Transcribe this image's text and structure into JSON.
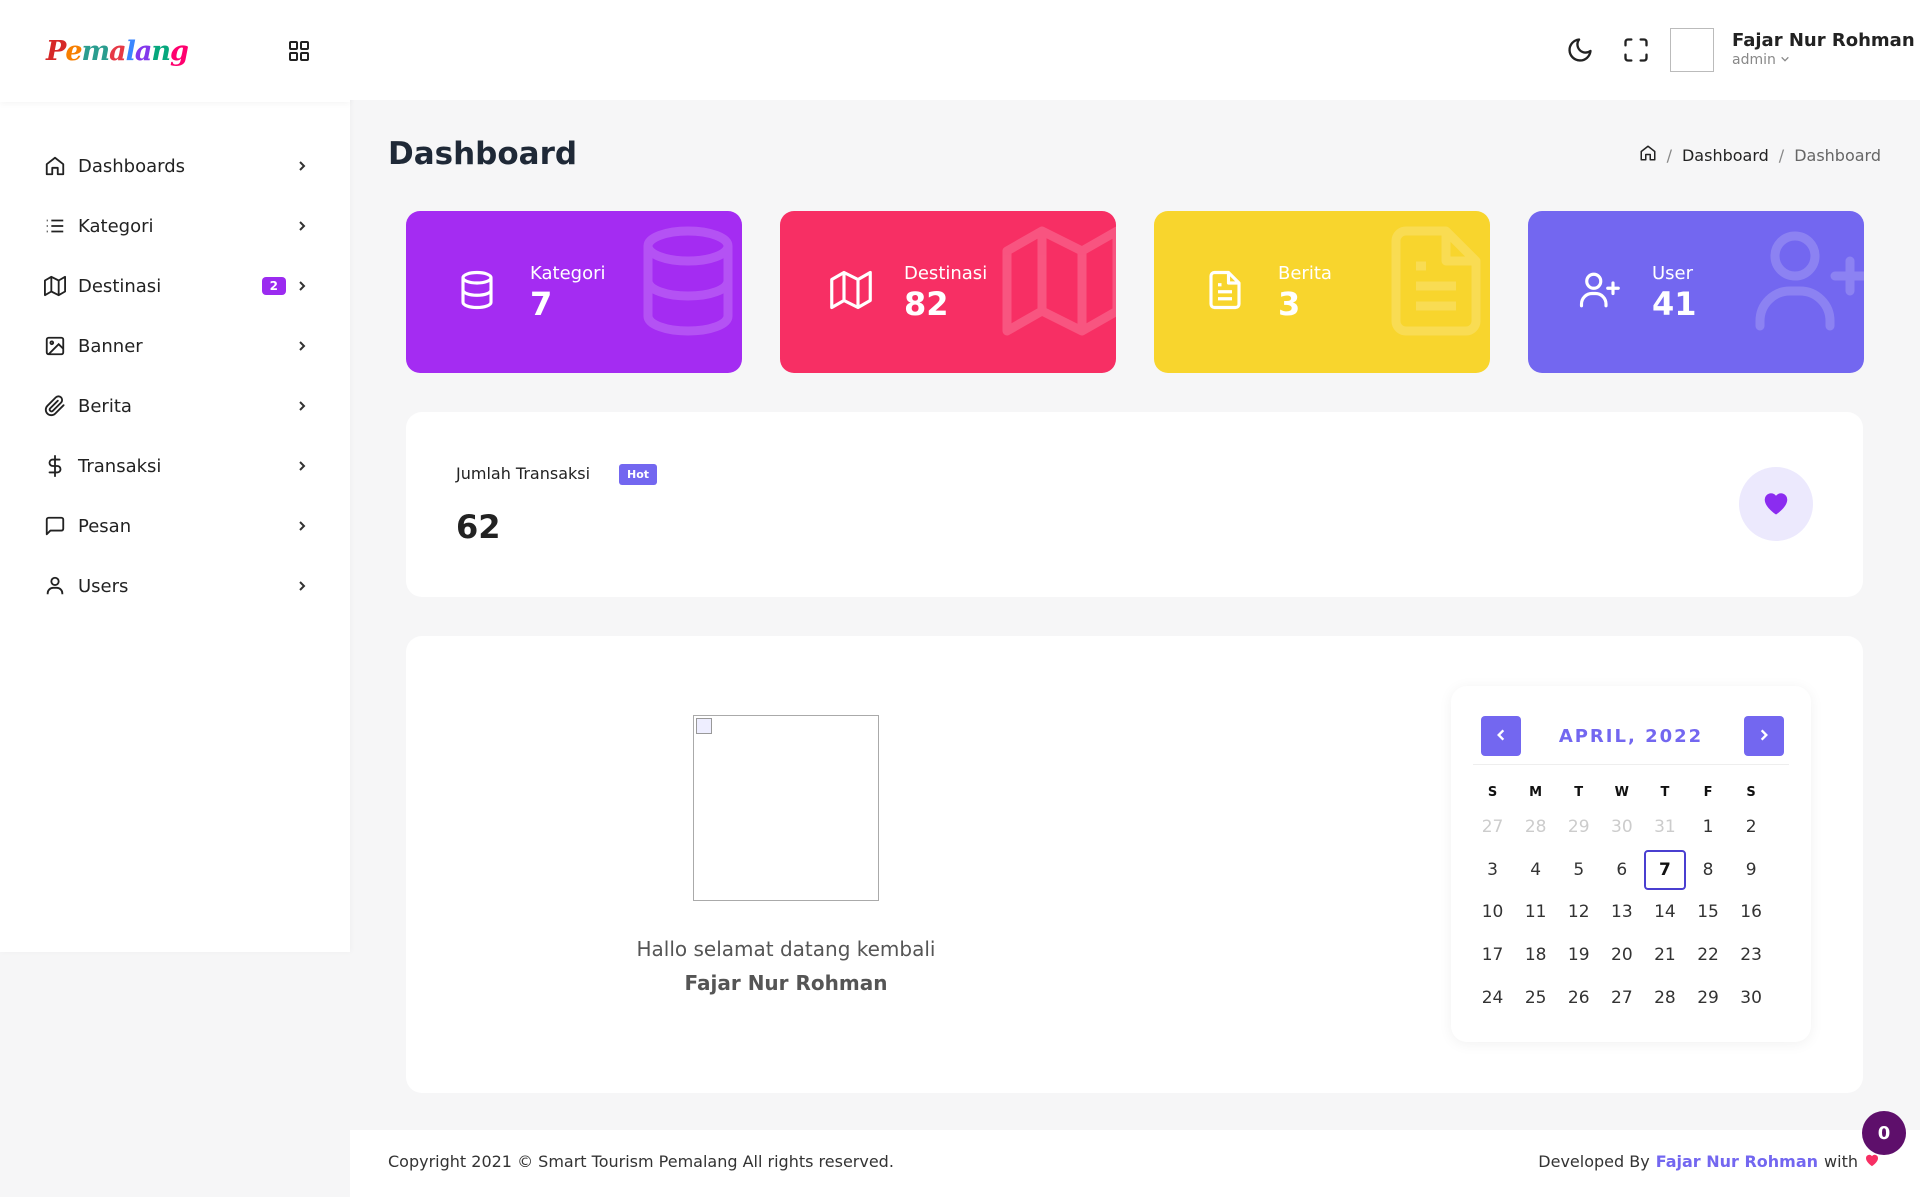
{
  "brand": {
    "logo_text": "Pemalang"
  },
  "sidebar": {
    "items": [
      {
        "label": "Dashboards",
        "icon": "home-icon"
      },
      {
        "label": "Kategori",
        "icon": "list-icon"
      },
      {
        "label": "Destinasi",
        "icon": "map-icon",
        "badge": "2"
      },
      {
        "label": "Banner",
        "icon": "image-icon"
      },
      {
        "label": "Berita",
        "icon": "paperclip-icon"
      },
      {
        "label": "Transaksi",
        "icon": "dollar-icon"
      },
      {
        "label": "Pesan",
        "icon": "message-icon"
      },
      {
        "label": "Users",
        "icon": "user-icon"
      }
    ]
  },
  "header": {
    "user_name": "Fajar Nur Rohman",
    "user_role": "admin"
  },
  "page": {
    "title": "Dashboard",
    "breadcrumb": [
      "Dashboard",
      "Dashboard"
    ]
  },
  "stats": [
    {
      "label": "Kategori",
      "value": "7",
      "color": "#a42cf2"
    },
    {
      "label": "Destinasi",
      "value": "82",
      "color": "#f72f64"
    },
    {
      "label": "Berita",
      "value": "3",
      "color": "#f8d52d"
    },
    {
      "label": "User",
      "value": "41",
      "color": "#7367f0"
    }
  ],
  "transaksi": {
    "label": "Jumlah Transaksi",
    "badge": "Hot",
    "value": "62"
  },
  "welcome": {
    "greeting": "Hallo selamat datang kembali",
    "name": "Fajar Nur Rohman"
  },
  "calendar": {
    "title": "APRIL, 2022",
    "weekdays": [
      "S",
      "M",
      "T",
      "W",
      "T",
      "F",
      "S"
    ],
    "selected_day": "7",
    "days": [
      {
        "d": "27",
        "m": true
      },
      {
        "d": "28",
        "m": true
      },
      {
        "d": "29",
        "m": true
      },
      {
        "d": "30",
        "m": true
      },
      {
        "d": "31",
        "m": true
      },
      {
        "d": "1"
      },
      {
        "d": "2"
      },
      {
        "d": "3"
      },
      {
        "d": "4"
      },
      {
        "d": "5"
      },
      {
        "d": "6"
      },
      {
        "d": "7"
      },
      {
        "d": "8"
      },
      {
        "d": "9"
      },
      {
        "d": "10"
      },
      {
        "d": "11"
      },
      {
        "d": "12"
      },
      {
        "d": "13"
      },
      {
        "d": "14"
      },
      {
        "d": "15"
      },
      {
        "d": "16"
      },
      {
        "d": "17"
      },
      {
        "d": "18"
      },
      {
        "d": "19"
      },
      {
        "d": "20"
      },
      {
        "d": "21"
      },
      {
        "d": "22"
      },
      {
        "d": "23"
      },
      {
        "d": "24"
      },
      {
        "d": "25"
      },
      {
        "d": "26"
      },
      {
        "d": "27"
      },
      {
        "d": "28"
      },
      {
        "d": "29"
      },
      {
        "d": "30"
      }
    ]
  },
  "footer": {
    "copyright": "Copyright 2021 © Smart Tourism Pemalang All rights reserved.",
    "dev_prefix": "Developed By",
    "dev_name": "Fajar Nur Rohman",
    "dev_suffix": "with"
  },
  "floating_badge": "0"
}
